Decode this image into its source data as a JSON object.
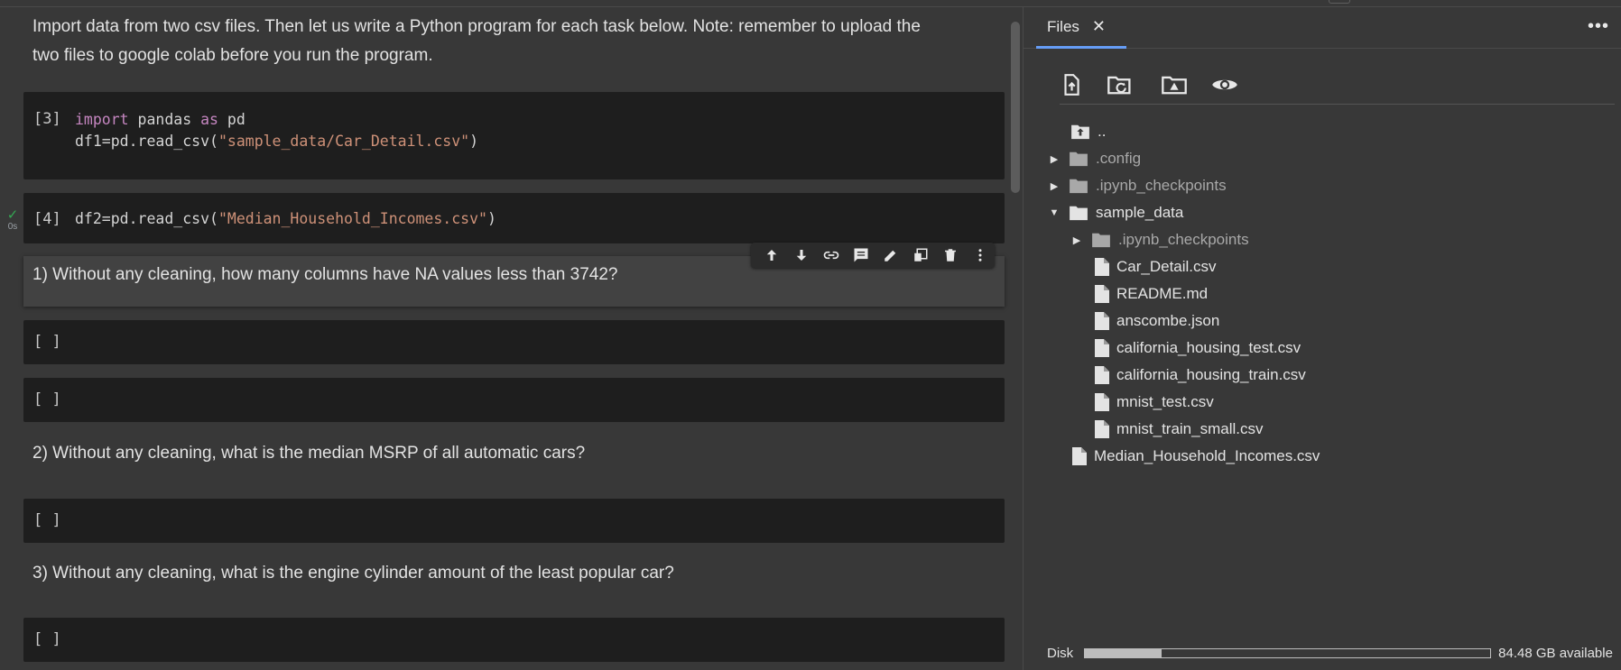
{
  "notebook": {
    "intro_line1": "Import data from two csv files. Then let us write a Python program for each task below. Note: remember to upload the",
    "intro_line2": "two files to google colab before you run the program.",
    "cell3": {
      "prompt": "[3]",
      "line1_kw1": "import",
      "line1_mid": " pandas ",
      "line1_kw2": "as",
      "line1_end": " pd",
      "line2_pre": "df1=pd.read_csv(",
      "line2_str": "\"sample_data/Car_Detail.csv\"",
      "line2_post": ")"
    },
    "cell4": {
      "prompt": "[4]",
      "exec_check": "✓",
      "exec_time": "0s",
      "line_pre": "df2=pd.read_csv(",
      "line_str": "\"Median_Household_Incomes.csv\"",
      "line_post": ")"
    },
    "q1": "1) Without any cleaning, how many columns have NA values less than 3742?",
    "q2": "2) Without any cleaning, what is the median MSRP of all automatic cars?",
    "q3": "3) Without any cleaning, what is the engine cylinder amount of the least popular car?",
    "empty_prompt": "[ ]",
    "toolbar_icons": [
      "arrow-up-icon",
      "arrow-down-icon",
      "link-icon",
      "comment-icon",
      "edit-icon",
      "mirror-cell-icon",
      "delete-icon",
      "more-vert-icon"
    ]
  },
  "files": {
    "tab_label": "Files",
    "tab_close": "✕",
    "more": "•••",
    "toolbar_icons": [
      "upload-file-icon",
      "refresh-folder-icon",
      "mount-drive-icon",
      "show-hidden-icon"
    ],
    "tree": [
      {
        "name": "..",
        "type": "up"
      },
      {
        "name": ".config",
        "type": "folder",
        "expanded": false,
        "hidden": true
      },
      {
        "name": ".ipynb_checkpoints",
        "type": "folder",
        "expanded": false,
        "hidden": true
      },
      {
        "name": "sample_data",
        "type": "folder",
        "expanded": true,
        "hidden": false
      },
      {
        "name": ".ipynb_checkpoints",
        "type": "folder",
        "expanded": false,
        "hidden": true
      },
      {
        "name": "Car_Detail.csv",
        "type": "file"
      },
      {
        "name": "README.md",
        "type": "file"
      },
      {
        "name": "anscombe.json",
        "type": "file"
      },
      {
        "name": "california_housing_test.csv",
        "type": "file"
      },
      {
        "name": "california_housing_train.csv",
        "type": "file"
      },
      {
        "name": "mnist_test.csv",
        "type": "file"
      },
      {
        "name": "mnist_train_small.csv",
        "type": "file"
      },
      {
        "name": "Median_Household_Incomes.csv",
        "type": "file"
      }
    ],
    "disk_label": "Disk",
    "disk_used_fraction": 0.19,
    "disk_available": "84.48 GB available"
  }
}
